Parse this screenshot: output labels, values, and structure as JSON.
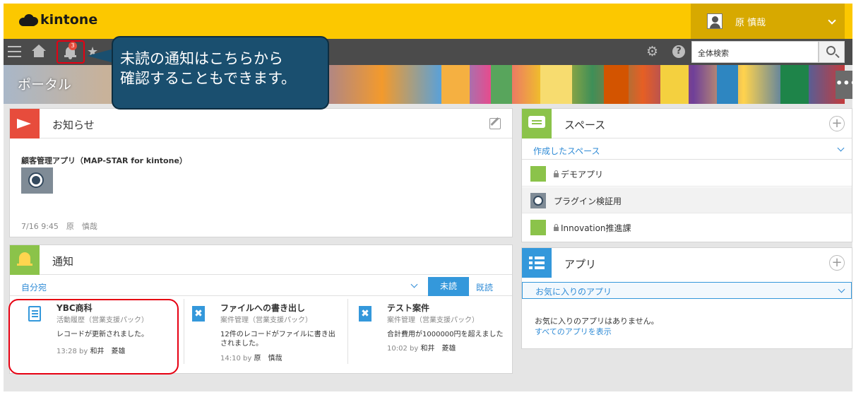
{
  "app": {
    "logo_text": "kintone"
  },
  "header": {
    "user_name": "原 慎哉"
  },
  "toolbar": {
    "notification_count": "3",
    "search_placeholder": "全体検索"
  },
  "banner": {
    "title": "ポータル",
    "more_label": "•••"
  },
  "callout": {
    "line1": "未読の通知はこちらから",
    "line2": "確認することもできます。"
  },
  "info_panel": {
    "title": "お知らせ",
    "item_title": "顧客管理アプリ（MAP-STAR for kintone）",
    "meta": "7/16 9:45　原　慎哉"
  },
  "notifications_panel": {
    "title": "通知",
    "filter_label": "自分宛",
    "unread_label": "未読",
    "read_label": "既読",
    "items": [
      {
        "title": "YBC商科",
        "subtitle": "活動履歴（営業支援パック）",
        "body": "レコードが更新されました。",
        "time": "13:28",
        "by": "by",
        "user": "和井　菱雄"
      },
      {
        "title": "ファイルへの書き出し",
        "subtitle": "案件管理（営業支援パック）",
        "body": "12件のレコードがファイルに書き出されました。",
        "time": "14:10",
        "by": "by",
        "user": "原　慎哉"
      },
      {
        "title": "テスト案件",
        "subtitle": "案件管理（営業支援パック）",
        "body": "合計費用が1000000円を超えました",
        "time": "10:02",
        "by": "by",
        "user": "和井　菱雄"
      }
    ]
  },
  "spaces_panel": {
    "title": "スペース",
    "filter_label": "作成したスペース",
    "items": [
      {
        "label": "デモアプリ",
        "locked": true
      },
      {
        "label": "プラグイン検証用",
        "locked": false
      },
      {
        "label": "Innovation推進課",
        "locked": true
      }
    ]
  },
  "apps_panel": {
    "title": "アプリ",
    "filter_label": "お気に入りのアプリ",
    "empty_text": "お気に入りのアプリはありません。",
    "show_all_link": "すべてのアプリを表示"
  },
  "colors": {
    "header_yellow": "#fcc800",
    "toolbar_gray": "#4b4b4b",
    "info_red": "#e74c3c",
    "notify_green": "#8bc34a",
    "space_green": "#8bc34a",
    "app_blue": "#3498db",
    "link_blue": "#2f8bd6",
    "callout_navy": "#1a4f6f",
    "highlight_red": "#e60012"
  }
}
